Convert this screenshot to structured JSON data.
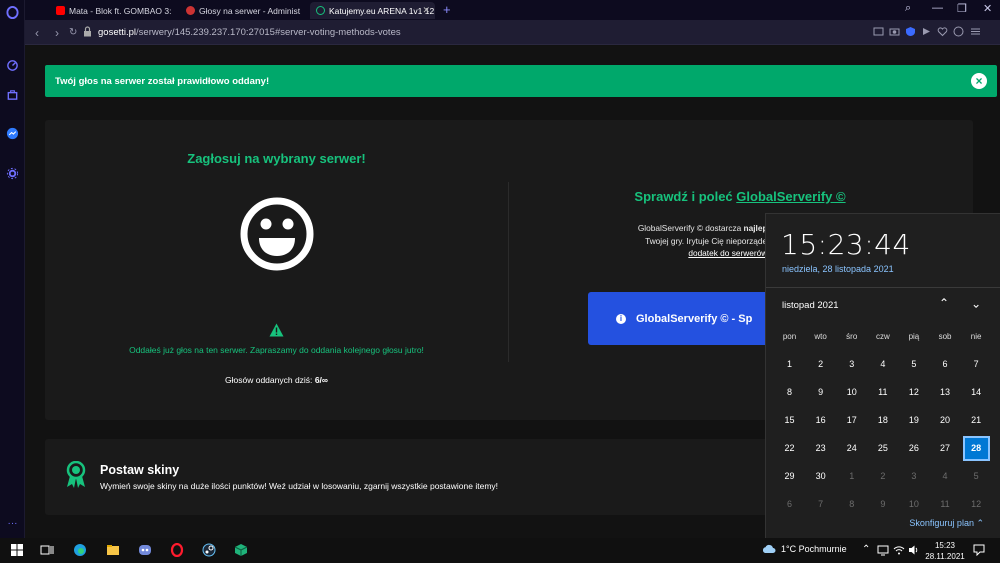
{
  "browser": {
    "tabs": [
      {
        "label": "Mata - Blok ft. GOMBAO 3:",
        "color": "#ff0000"
      },
      {
        "label": "Głosy na serwer - Administ",
        "color": "#d44"
      },
      {
        "label": "Katujemy.eu ARENA 1v1 12",
        "color": "#17c27d"
      }
    ],
    "new_tab": "+",
    "url_host": "gosetti.pl",
    "url_path": "/serwery/145.239.237.170:27015#server-voting-methods-votes"
  },
  "alert": {
    "message": "Twój głos na serwer został prawidłowo oddany!",
    "close": "×"
  },
  "vote": {
    "title": "Zagłosuj na wybrany serwer!",
    "already_voted": "Oddałeś już głos na ten serwer. Zapraszamy do oddania kolejnego głosu jutro!",
    "votes_today_label": "Głosów oddanych dziś:",
    "votes_today_value": "6/∞"
  },
  "globalserverify": {
    "title_prefix": "Sprawdź i poleć ",
    "title_link": "GlobalServerify ©",
    "desc_start": "GlobalServerify © dostarcza ",
    "desc_bold": "najlepsze, sprawdzone, po",
    "desc_line2": "Twojej gry. Irytuje Cię nieporządek we wbudowanej w",
    "desc_link": "dodatek do serwerów społecz",
    "button": "GlobalServerify © - Sp"
  },
  "skins": {
    "title": "Postaw skiny",
    "description": "Wymień swoje skiny na duże ilości punktów! Weź udział w losowaniu, zgarnij wszystkie postawione itemy!"
  },
  "calendar": {
    "time": "15:23:44",
    "date": "niedziela, 28 listopada 2021",
    "month": "listopad 2021",
    "weekdays": [
      "pon",
      "wto",
      "śro",
      "czw",
      "pią",
      "sob",
      "nie"
    ],
    "weeks": [
      [
        "1",
        "2",
        "3",
        "4",
        "5",
        "6",
        "7"
      ],
      [
        "8",
        "9",
        "10",
        "11",
        "12",
        "13",
        "14"
      ],
      [
        "15",
        "16",
        "17",
        "18",
        "19",
        "20",
        "21"
      ],
      [
        "22",
        "23",
        "24",
        "25",
        "26",
        "27",
        "28"
      ],
      [
        "29",
        "30",
        "1",
        "2",
        "3",
        "4",
        "5"
      ],
      [
        "6",
        "7",
        "8",
        "9",
        "10",
        "11",
        "12"
      ]
    ],
    "today": "28",
    "configure": "Skonfiguruj plan"
  },
  "taskbar": {
    "weather": "1°C  Pochmurnie",
    "clock_time": "15:23",
    "clock_date": "28.11.2021"
  },
  "colors": {
    "accent_green": "#17c27d",
    "alert_green": "#00a86b",
    "button_blue": "#2451e0"
  }
}
